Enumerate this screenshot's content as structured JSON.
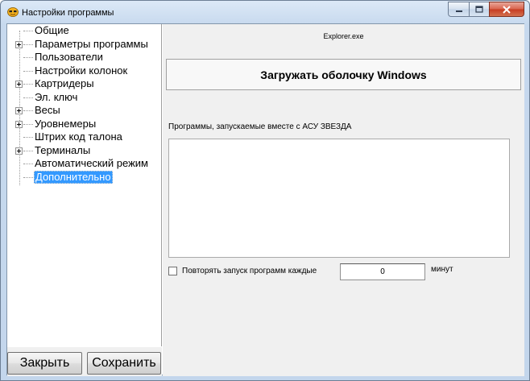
{
  "window": {
    "title": "Настройки программы"
  },
  "tree": {
    "items": [
      {
        "label": "Общие",
        "expandable": false,
        "selected": false
      },
      {
        "label": "Параметры программы",
        "expandable": true,
        "selected": false
      },
      {
        "label": "Пользователи",
        "expandable": false,
        "selected": false
      },
      {
        "label": "Настройки колонок",
        "expandable": false,
        "selected": false
      },
      {
        "label": "Картридеры",
        "expandable": true,
        "selected": false
      },
      {
        "label": "Эл. ключ",
        "expandable": false,
        "selected": false
      },
      {
        "label": "Весы",
        "expandable": true,
        "selected": false
      },
      {
        "label": "Уровнемеры",
        "expandable": true,
        "selected": false
      },
      {
        "label": "Штрих код талона",
        "expandable": false,
        "selected": false
      },
      {
        "label": "Терминалы",
        "expandable": true,
        "selected": false
      },
      {
        "label": "Автоматический режим",
        "expandable": false,
        "selected": false
      },
      {
        "label": "Дополнительно",
        "expandable": false,
        "selected": true
      }
    ]
  },
  "buttons": {
    "close_label": "Закрыть",
    "save_label": "Сохранить"
  },
  "panel": {
    "shell_exe": "Explorer.exe",
    "shell_button_label": "Загружать оболочку Windows",
    "programs_label": "Программы, запускаемые вместе с АСУ ЗВЕЗДА",
    "repeat_label": "Повторять запуск программ каждые",
    "repeat_checked": false,
    "repeat_minutes_value": "0",
    "minutes_unit": "минут"
  }
}
